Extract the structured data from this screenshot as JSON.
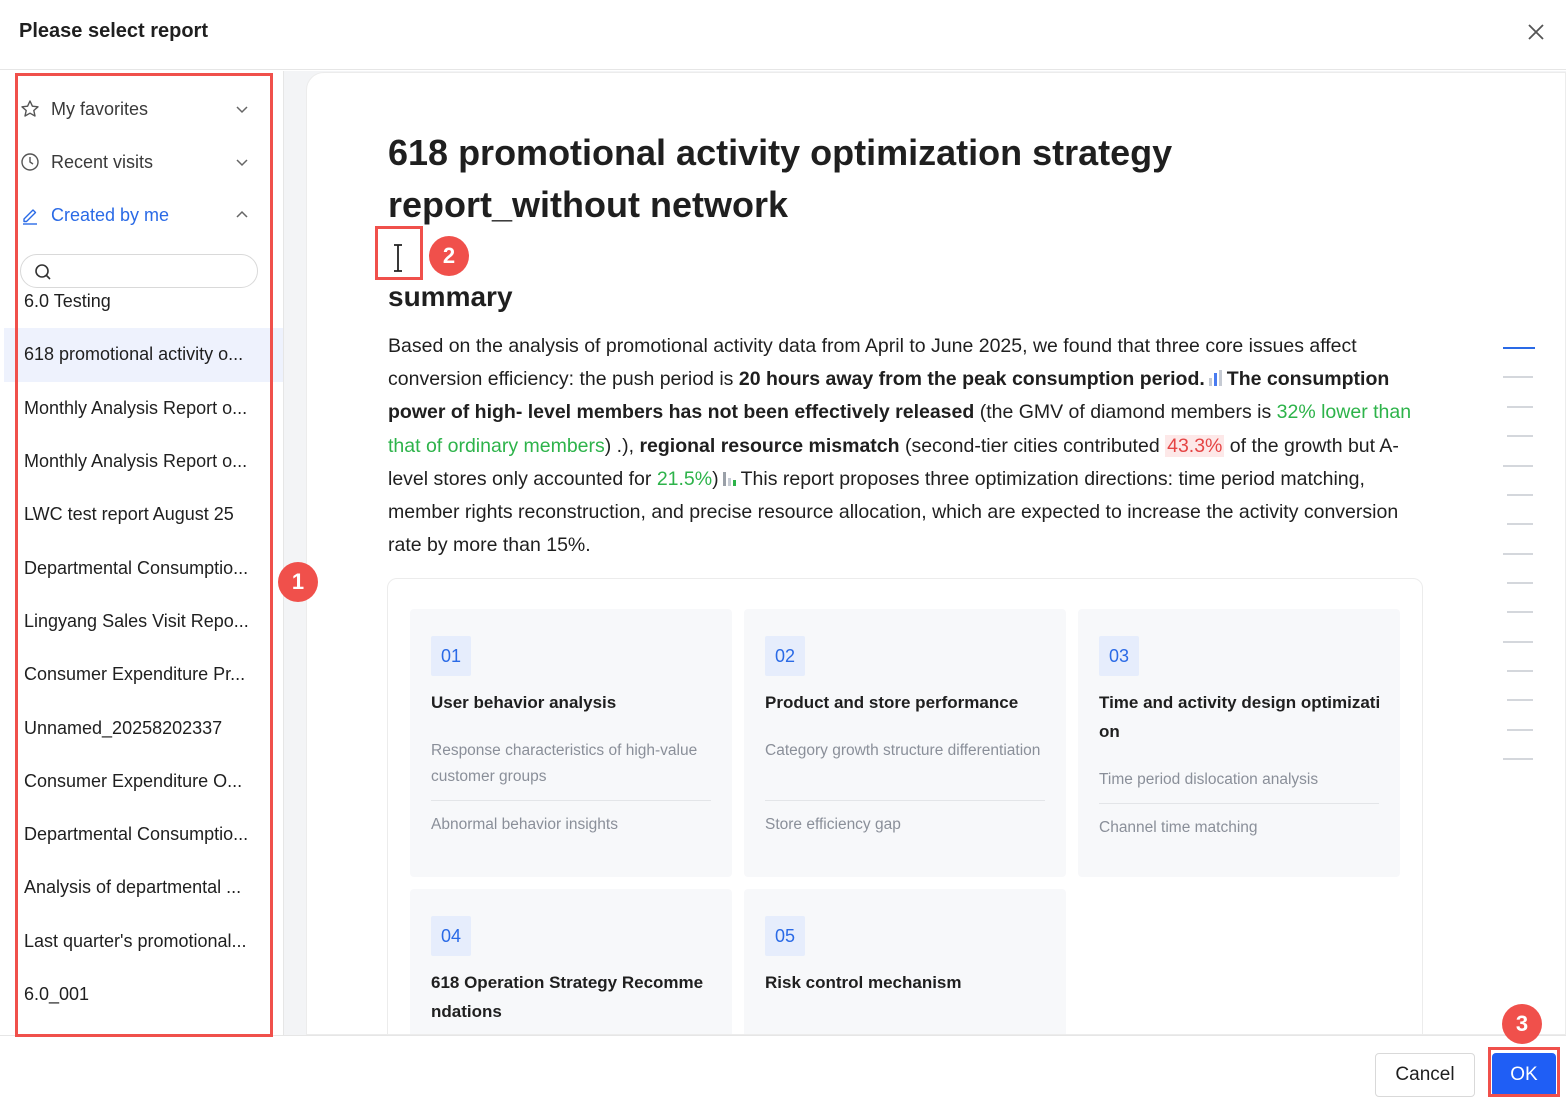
{
  "dialog": {
    "title": "Please select report",
    "close_icon": "close-icon"
  },
  "sidebar": {
    "sections": [
      {
        "label": "My favorites",
        "icon": "star-icon",
        "expanded": false
      },
      {
        "label": "Recent visits",
        "icon": "clock-icon",
        "expanded": false
      },
      {
        "label": "Created by me",
        "icon": "edit-icon",
        "expanded": true
      }
    ],
    "search": {
      "placeholder": "",
      "value": ""
    },
    "reports": [
      "6.0 Testing",
      "618 promotional activity o...",
      "Monthly Analysis Report o...",
      "Monthly Analysis Report o...",
      "LWC test report August 25",
      "Departmental Consumptio...",
      "Lingyang Sales Visit Repo...",
      "Consumer Expenditure Pr...",
      "Unnamed_20258202337",
      "Consumer Expenditure O...",
      "Departmental Consumptio...",
      "Analysis of departmental ...",
      "Last quarter's promotional...",
      "6.0_001"
    ],
    "selected_index": 1
  },
  "preview": {
    "title": "618 promotional activity optimization strategy report_without network",
    "summary_heading": "summary",
    "summary": {
      "p1": "Based on the analysis of promotional activity data from April to June 2025, we found that three core issues affect conversion efficiency: the push period is ",
      "b1": "20 hours away from the peak consumption period.",
      "b2": "The consumption power of high- level members has not been effectively released",
      "p2": " (the GMV of diamond members is ",
      "g1": "32% lower than that of ordinary members",
      "p3": ") .), ",
      "b3": "regional resource mismatch",
      "p4": " (second-tier cities contributed ",
      "r1": "43.3%",
      "p5": " of the growth but A-level stores only accounted for ",
      "g2": "21.5%",
      "p6": ")",
      "p7": "This report proposes three optimization directions: time period matching, member rights reconstruction, and precise resource allocation, which are expected to increase the activity conversion rate by more than 15%."
    },
    "cards": [
      {
        "num": "01",
        "title": "User behavior analysis",
        "items": [
          "Response characteristics of high-value customer groups",
          "Abnormal behavior insights"
        ]
      },
      {
        "num": "02",
        "title": "Product and store performance",
        "items": [
          "Category growth structure differentiation",
          "Store efficiency gap"
        ]
      },
      {
        "num": "03",
        "title": "Time and activity design optimizati on",
        "items": [
          "Time period dislocation analysis",
          "Channel time matching"
        ]
      },
      {
        "num": "04",
        "title": "618 Operation Strategy Recomme ndations",
        "items": []
      },
      {
        "num": "05",
        "title": "Risk control mechanism",
        "items": []
      }
    ]
  },
  "annotations": [
    "1",
    "2",
    "3"
  ],
  "footer": {
    "cancel_label": "Cancel",
    "ok_label": "OK"
  },
  "colors": {
    "accent": "#2a6ae6",
    "ok_button": "#1f5ef5",
    "annotation": "#f0504b",
    "positive": "#2db34a",
    "negative": "#e54545"
  }
}
